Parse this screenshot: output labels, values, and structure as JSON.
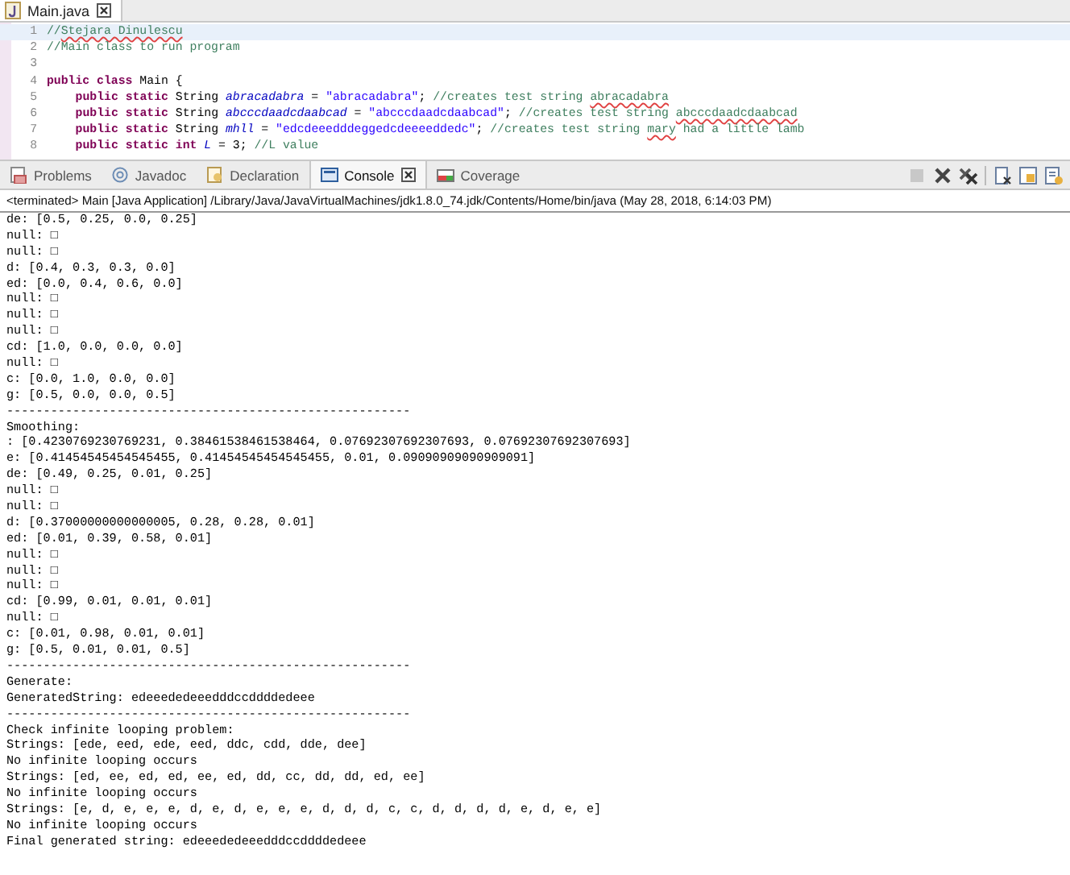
{
  "editor_tab": {
    "label": "Main.java",
    "selected": true
  },
  "code_lines": [
    {
      "number": "1",
      "current": true,
      "tokens": [
        {
          "kind": "comment",
          "text": "//"
        },
        {
          "kind": "flagged",
          "text": "Stejara Dinulescu"
        }
      ]
    },
    {
      "number": "2",
      "current": false,
      "tokens": [
        {
          "kind": "comment",
          "text": "//Main class to run program"
        }
      ]
    },
    {
      "number": "3",
      "current": false
    },
    {
      "number": "4",
      "current": false,
      "tokens": [
        {
          "kind": "keyword",
          "text": "public class"
        },
        {
          "kind": "plain",
          "text": " Main {"
        }
      ]
    },
    {
      "number": "5",
      "current": false,
      "indented": true,
      "tokens": [
        {
          "kind": "keyword",
          "text": "public static"
        },
        {
          "kind": "plain",
          "text": " String "
        },
        {
          "kind": "field",
          "text": "abracadabra"
        },
        {
          "kind": "plain",
          "text": " = "
        },
        {
          "kind": "string",
          "text": "\"abracadabra\""
        },
        {
          "kind": "plain",
          "text": "; "
        },
        {
          "kind": "comment",
          "text": "//creates test string "
        },
        {
          "kind": "flagged",
          "text": "abracadabra"
        }
      ]
    },
    {
      "number": "6",
      "current": false,
      "indented": true,
      "tokens": [
        {
          "kind": "keyword",
          "text": "public static"
        },
        {
          "kind": "plain",
          "text": " String "
        },
        {
          "kind": "field",
          "text": "abcccdaadcdaabcad"
        },
        {
          "kind": "plain",
          "text": " = "
        },
        {
          "kind": "string",
          "text": "\"abcccdaadcdaabcad\""
        },
        {
          "kind": "plain",
          "text": "; "
        },
        {
          "kind": "comment",
          "text": "//creates test string "
        },
        {
          "kind": "flagged",
          "text": "abcccdaadcdaabcad"
        }
      ]
    },
    {
      "number": "7",
      "current": false,
      "indented": true,
      "tokens": [
        {
          "kind": "keyword",
          "text": "public static"
        },
        {
          "kind": "plain",
          "text": " String "
        },
        {
          "kind": "field",
          "text": "mhll"
        },
        {
          "kind": "plain",
          "text": " = "
        },
        {
          "kind": "string",
          "text": "\"edcdeeedddeggedcdeeeeddedc\""
        },
        {
          "kind": "plain",
          "text": "; "
        },
        {
          "kind": "comment",
          "text": "//creates test string "
        },
        {
          "kind": "flagged",
          "text": "mary"
        },
        {
          "kind": "comment",
          "text": " had a little lamb"
        }
      ]
    },
    {
      "number": "8",
      "current": false,
      "indented": true,
      "tokens": [
        {
          "kind": "keyword",
          "text": "public static int"
        },
        {
          "kind": "field",
          "text": " L"
        },
        {
          "kind": "plain",
          "text": " = 3; "
        },
        {
          "kind": "comment",
          "text": "//L value"
        }
      ]
    }
  ],
  "view_tabs": [
    {
      "label": "Problems",
      "selected": false,
      "closable": false
    },
    {
      "label": "Javadoc",
      "selected": false,
      "closable": false
    },
    {
      "label": "Declaration",
      "selected": false,
      "closable": false
    },
    {
      "label": "Console",
      "selected": true,
      "closable": true
    },
    {
      "label": "Coverage",
      "selected": false,
      "closable": false
    }
  ],
  "console": {
    "header": "<terminated> Main [Java Application] /Library/Java/JavaVirtualMachines/jdk1.8.0_74.jdk/Contents/Home/bin/java (May 28, 2018, 6:14:03 PM)",
    "lines": [
      "de: [0.5, 0.25, 0.0, 0.25]",
      "null: □",
      "null: □",
      "d: [0.4, 0.3, 0.3, 0.0]",
      "ed: [0.0, 0.4, 0.6, 0.0]",
      "null: □",
      "null: □",
      "null: □",
      "cd: [1.0, 0.0, 0.0, 0.0]",
      "null: □",
      "c: [0.0, 1.0, 0.0, 0.0]",
      "g: [0.5, 0.0, 0.0, 0.5]",
      "-------------------------------------------------------",
      "Smoothing:",
      ": [0.4230769230769231, 0.38461538461538464, 0.07692307692307693, 0.07692307692307693]",
      "e: [0.41454545454545455, 0.41454545454545455, 0.01, 0.09090909090909091]",
      "de: [0.49, 0.25, 0.01, 0.25]",
      "null: □",
      "null: □",
      "d: [0.37000000000000005, 0.28, 0.28, 0.01]",
      "ed: [0.01, 0.39, 0.58, 0.01]",
      "null: □",
      "null: □",
      "null: □",
      "cd: [0.99, 0.01, 0.01, 0.01]",
      "null: □",
      "c: [0.01, 0.98, 0.01, 0.01]",
      "g: [0.5, 0.01, 0.01, 0.5]",
      "-------------------------------------------------------",
      "Generate:",
      "GeneratedString: edeeededeeedddccddddedeee",
      "-------------------------------------------------------",
      "Check infinite looping problem:",
      "Strings: [ede, eed, ede, eed, ddc, cdd, dde, dee]",
      "No infinite looping occurs",
      "Strings: [ed, ee, ed, ed, ee, ed, dd, cc, dd, dd, ed, ee]",
      "No infinite looping occurs",
      "Strings: [e, d, e, e, e, d, e, d, e, e, e, d, d, d, c, c, d, d, d, d, e, d, e, e]",
      "No infinite looping occurs",
      "Final generated string: edeeededeeedddccddddedeee"
    ]
  }
}
